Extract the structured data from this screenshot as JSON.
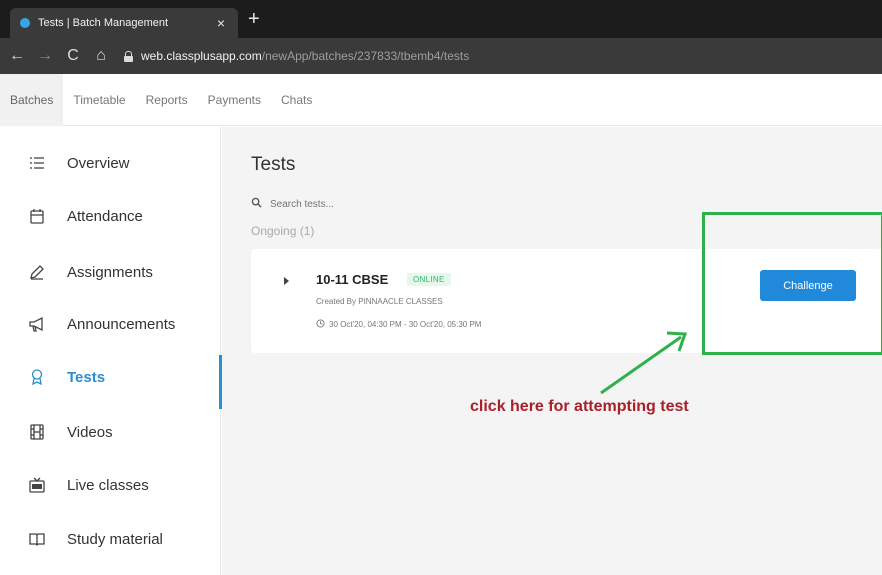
{
  "browser": {
    "tab_title": "Tests | Batch Management",
    "tab_close": "×",
    "new_tab": "+",
    "url_host": "web.classplusapp.com",
    "url_path": "/newApp/batches/237833/tbemb4/tests"
  },
  "topnav": {
    "items": [
      {
        "label": "Batches",
        "active": true
      },
      {
        "label": "Timetable"
      },
      {
        "label": "Reports"
      },
      {
        "label": "Payments"
      },
      {
        "label": "Chats"
      }
    ]
  },
  "sidebar": {
    "items": [
      {
        "label": "Overview",
        "icon": "list-icon"
      },
      {
        "label": "Attendance",
        "icon": "calendar-icon"
      },
      {
        "label": "Assignments",
        "icon": "pencil-icon"
      },
      {
        "label": "Announcements",
        "icon": "megaphone-icon"
      },
      {
        "label": "Tests",
        "icon": "award-icon",
        "active": true
      },
      {
        "label": "Videos",
        "icon": "film-icon"
      },
      {
        "label": "Live classes",
        "icon": "rec-icon"
      },
      {
        "label": "Study material",
        "icon": "book-icon"
      }
    ]
  },
  "main": {
    "title": "Tests",
    "search_placeholder": "Search tests...",
    "section_label": "Ongoing (1)",
    "test": {
      "name": "10-11 CBSE",
      "badge": "ONLINE",
      "created_by": "Created By PINNAACLE CLASSES",
      "time": "30 Oct'20, 04:30 PM - 30 Oct'20, 05:30 PM",
      "action_label": "Challenge"
    }
  },
  "annotation": {
    "text": "click here for attempting test",
    "color": "#a8202a",
    "box_color": "#2eb04a"
  },
  "colors": {
    "accent": "#2089d9",
    "online_badge": "#35b36a"
  }
}
